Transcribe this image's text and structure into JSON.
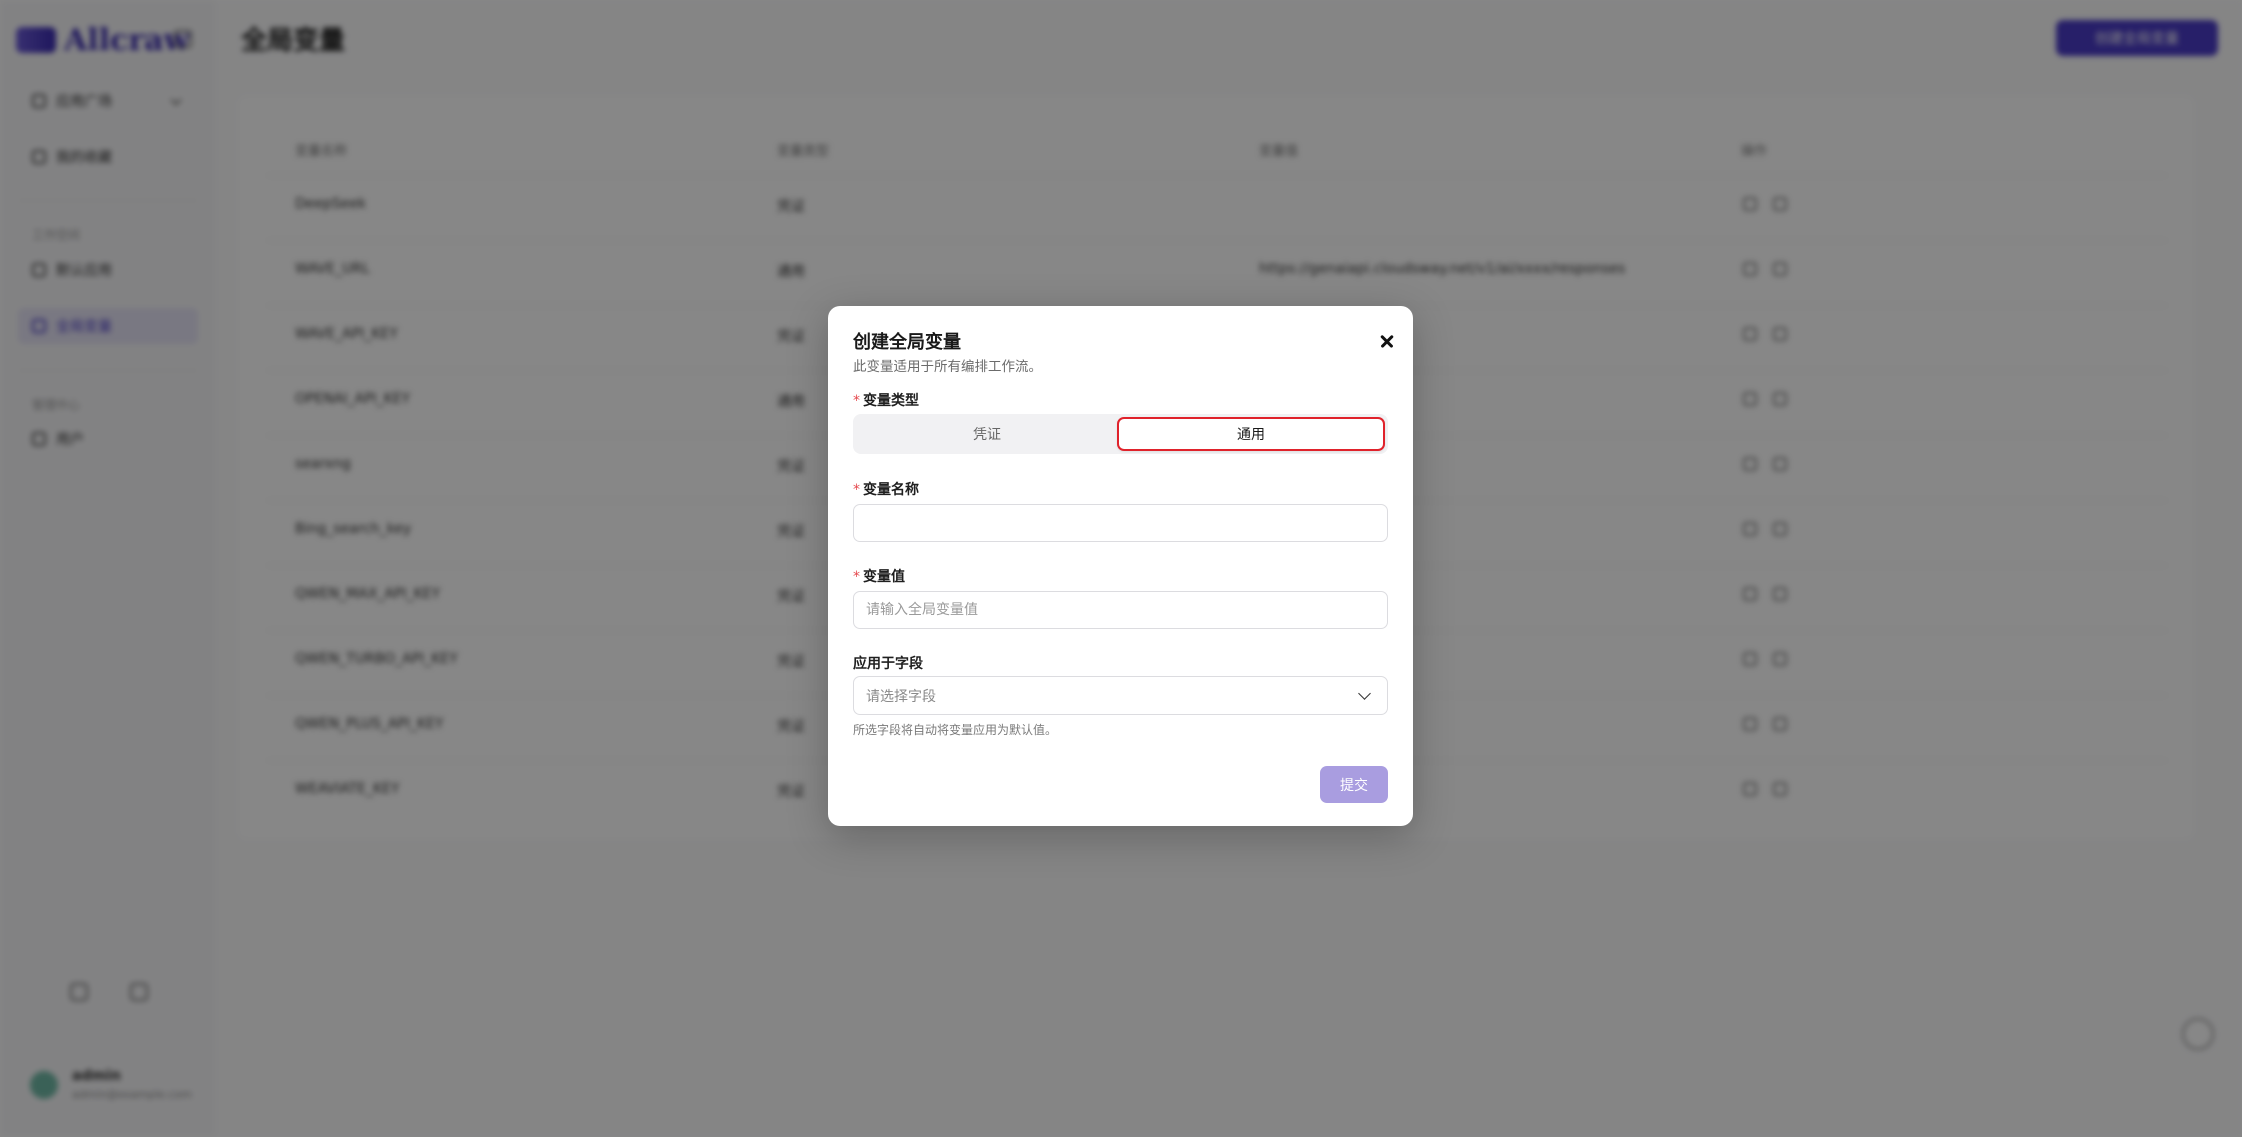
{
  "app": {
    "brand": "Allcraw",
    "page_title": "全局变量",
    "primary_action": "创建全局变量",
    "sidebar": {
      "items": [
        {
          "label": "应用广场"
        },
        {
          "label": "我的收藏"
        }
      ],
      "section_workspace": "工作空间",
      "workspace_items": [
        {
          "label": "默认应用"
        },
        {
          "label": "全局变量"
        }
      ],
      "section_admin": "管理中心",
      "admin_items": [
        {
          "label": "用户"
        }
      ],
      "user": {
        "name": "admin",
        "email": "admin@example.com"
      }
    },
    "table": {
      "headers": [
        "变量名称",
        "变量类型",
        "变量值",
        "操作"
      ],
      "rows": [
        {
          "name": "DeepSeek",
          "type": "凭证",
          "value": ""
        },
        {
          "name": "WAVE_URL",
          "type": "通用",
          "value": "https://genaiapi.cloudsway.net/v1/ai/xxxx/responses"
        },
        {
          "name": "WAVE_API_KEY",
          "type": "凭证",
          "value": ""
        },
        {
          "name": "OPENAI_API_KEY",
          "type": "通用",
          "value": ""
        },
        {
          "name": "searxng",
          "type": "凭证",
          "value": ""
        },
        {
          "name": "Bing_search_key",
          "type": "凭证",
          "value": ""
        },
        {
          "name": "QWEN_MAX_API_KEY",
          "type": "凭证",
          "value": ""
        },
        {
          "name": "QWEN_TURBO_API_KEY",
          "type": "凭证",
          "value": ""
        },
        {
          "name": "QWEN_PLUS_API_KEY",
          "type": "凭证",
          "value": ""
        },
        {
          "name": "WEAVIATE_KEY",
          "type": "凭证",
          "value": ""
        }
      ]
    }
  },
  "modal": {
    "title": "创建全局变量",
    "subtitle": "此变量适用于所有编排工作流。",
    "close_icon": "close-icon",
    "required_mark": "*",
    "type_label": "变量类型",
    "type_options": [
      {
        "label": "凭证",
        "selected": false
      },
      {
        "label": "通用",
        "selected": true
      }
    ],
    "name_label": "变量名称",
    "name_value": "",
    "name_placeholder": "",
    "value_label": "变量值",
    "value_placeholder": "请输入全局变量值",
    "field_label": "应用于字段",
    "field_placeholder": "请选择字段",
    "field_hint": "所选字段将自动将变量应用为默认值。",
    "submit_label": "提交"
  },
  "colors": {
    "accent": "#4a3bc6",
    "submit_disabled": "#a99de0",
    "highlight_border": "#e0222b",
    "required": "#e5484d",
    "overlay": "rgba(0,0,0,0.47)"
  }
}
